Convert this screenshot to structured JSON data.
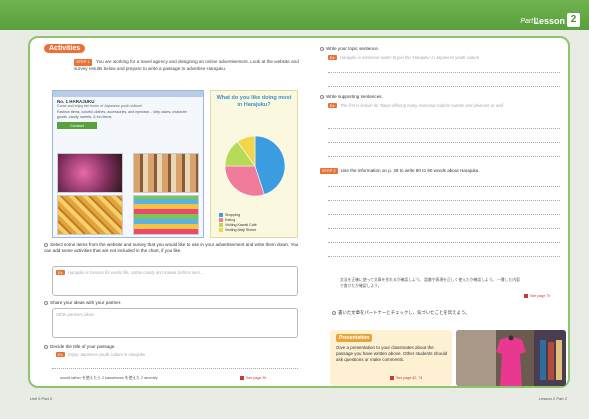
{
  "header": {
    "part_label": "Part 1",
    "lesson_label": "Lesson",
    "lesson_num": "2"
  },
  "activities": {
    "badge": "Activities",
    "step1_tag": "STEP 1",
    "intro": "You are working for a travel agency and designing an online advertisement. Look at the website and survey results below and prepare to write a passage to advertise Harajuku."
  },
  "website": {
    "title": "No. 1 HARAJUKU",
    "subtitle": "Come and enjoy the home of Japanese youth culture!",
    "desc": "Fashion items, colorful clothes, accessories, and eyewear… kitty cakes, character goods, candy, sweets, & fun items.",
    "button": "Contact"
  },
  "survey": {
    "title": "What do you like doing most in Harajuku?",
    "legend": [
      "Shopping",
      "Eating",
      "Visiting Kawaii Café",
      "Visiting Meiji Shrine"
    ]
  },
  "chart_data": {
    "type": "pie",
    "title": "What do you like doing most in Harajuku?",
    "categories": [
      "Shopping",
      "Eating",
      "Visiting Kawaii Café",
      "Visiting Meiji Shrine"
    ],
    "values": [
      45,
      30,
      15,
      10
    ],
    "colors": [
      "#3b9de0",
      "#f07b9a",
      "#b6d957",
      "#f3d54a"
    ]
  },
  "left_col": {
    "q1": "Select some items from the website and survey that you would like to use in your advertisement and write them down. You can add some activities that are not included in the chart, if you like.",
    "q1_tag": "Ex",
    "q1_hint": "Harajuku is famous for exotic life, cotton candy and Kawaii fashion item...",
    "q2": "Share your ideas with your partner.",
    "q2_hint": "Other partners ideas",
    "q3": "Decide the title of your passage.",
    "q3_tag": "Ex",
    "q3_hint": "Enjoy Japanese youth culture in Harajuku",
    "footer_note": "would rather  を使えたら 2 kawaiiness  を使えた 2 amenity",
    "ref": "See page 90"
  },
  "right_col": {
    "q4": "Write your topic sentence.",
    "q4_tag": "Ex",
    "q4_hint": "Harajuku is someone wants to join the 'Harajuku' in Japanese youth culture",
    "q5": "Write supporting sentences.",
    "q5_tag": "Ex",
    "q5_hint": "The first is known for Tokyo offering many seasonal colorful sweets and pleasant as well",
    "step2_tag": "STEP 2",
    "step2": "Use the information on p. 28 to write 80 to 90 words about Harajuku.",
    "check_note": "文法を正確に使って文章を作れるか確認しよう。 語彙や表現を正しく使えたか確認しよう。 一貫した内容で書けたか確認しよう。",
    "ref": "See page 79",
    "jp_instruction": "書いた文章をパートナーとチェックし、気づいたことを伝えよう。"
  },
  "present": {
    "tag": "Presentation",
    "text": "Give a presentation to your classmates about the passage you have written above. Other students should ask questions or make comments.",
    "ref": "See page 62, 74"
  },
  "footer": {
    "left": "Unit 5  Part 2",
    "right": "Lesson 2  Part 2"
  }
}
